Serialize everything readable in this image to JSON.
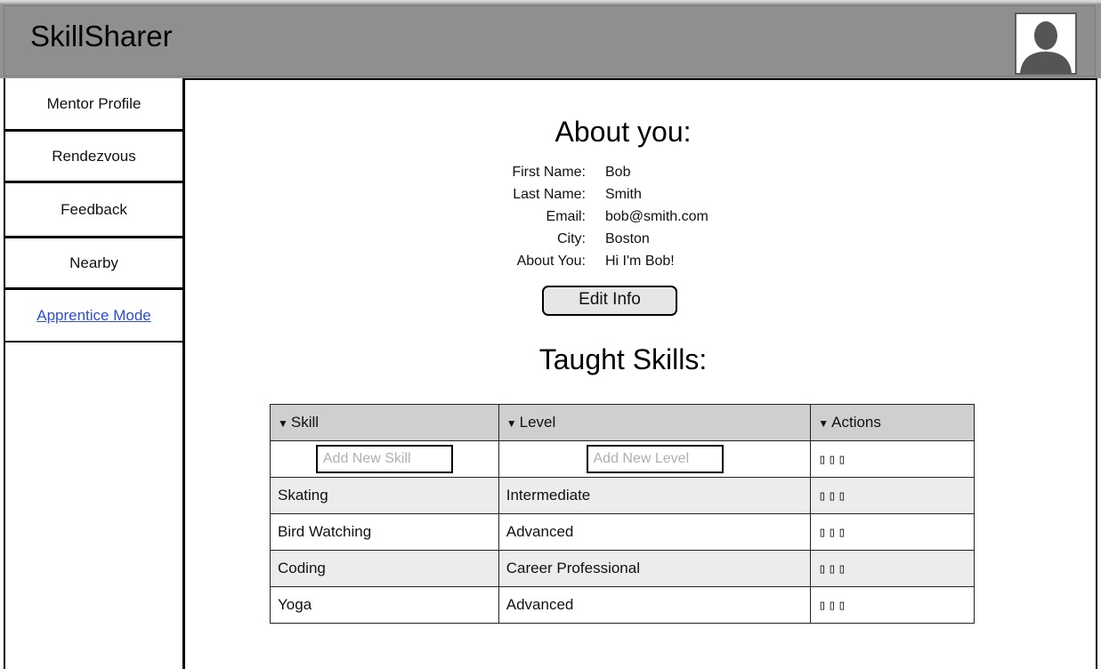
{
  "header": {
    "app_title": "SkillSharer",
    "avatar_icon": "user-avatar-icon"
  },
  "sidebar": {
    "items": [
      {
        "label": "Mentor Profile"
      },
      {
        "label": "Rendezvous"
      },
      {
        "label": "Feedback"
      },
      {
        "label": "Nearby"
      },
      {
        "label": "Apprentice Mode"
      }
    ]
  },
  "about": {
    "title": "About you:",
    "fields": [
      {
        "label": "First Name:",
        "value": "Bob"
      },
      {
        "label": "Last Name:",
        "value": "Smith"
      },
      {
        "label": "Email:",
        "value": "bob@smith.com"
      },
      {
        "label": "City:",
        "value": "Boston"
      },
      {
        "label": "About You:",
        "value": "Hi I'm Bob!"
      }
    ],
    "edit_button": "Edit Info"
  },
  "skills": {
    "title": "Taught Skills:",
    "sort_icon": "▼",
    "columns": [
      "Skill",
      "Level",
      "Actions"
    ],
    "new_skill_placeholder": "Add New Skill",
    "new_level_placeholder": "Add New Level",
    "action_glyphs": "▯▯▯",
    "rows": [
      {
        "skill": "Skating",
        "level": "Intermediate"
      },
      {
        "skill": "Bird Watching",
        "level": "Advanced"
      },
      {
        "skill": "Coding",
        "level": "Career Professional"
      },
      {
        "skill": "Yoga",
        "level": "Advanced"
      }
    ]
  },
  "colors": {
    "header_bg": "#939393",
    "link": "#2a4fd6",
    "table_header_bg": "#cfcfcf",
    "row_alt_bg": "#ececec"
  }
}
